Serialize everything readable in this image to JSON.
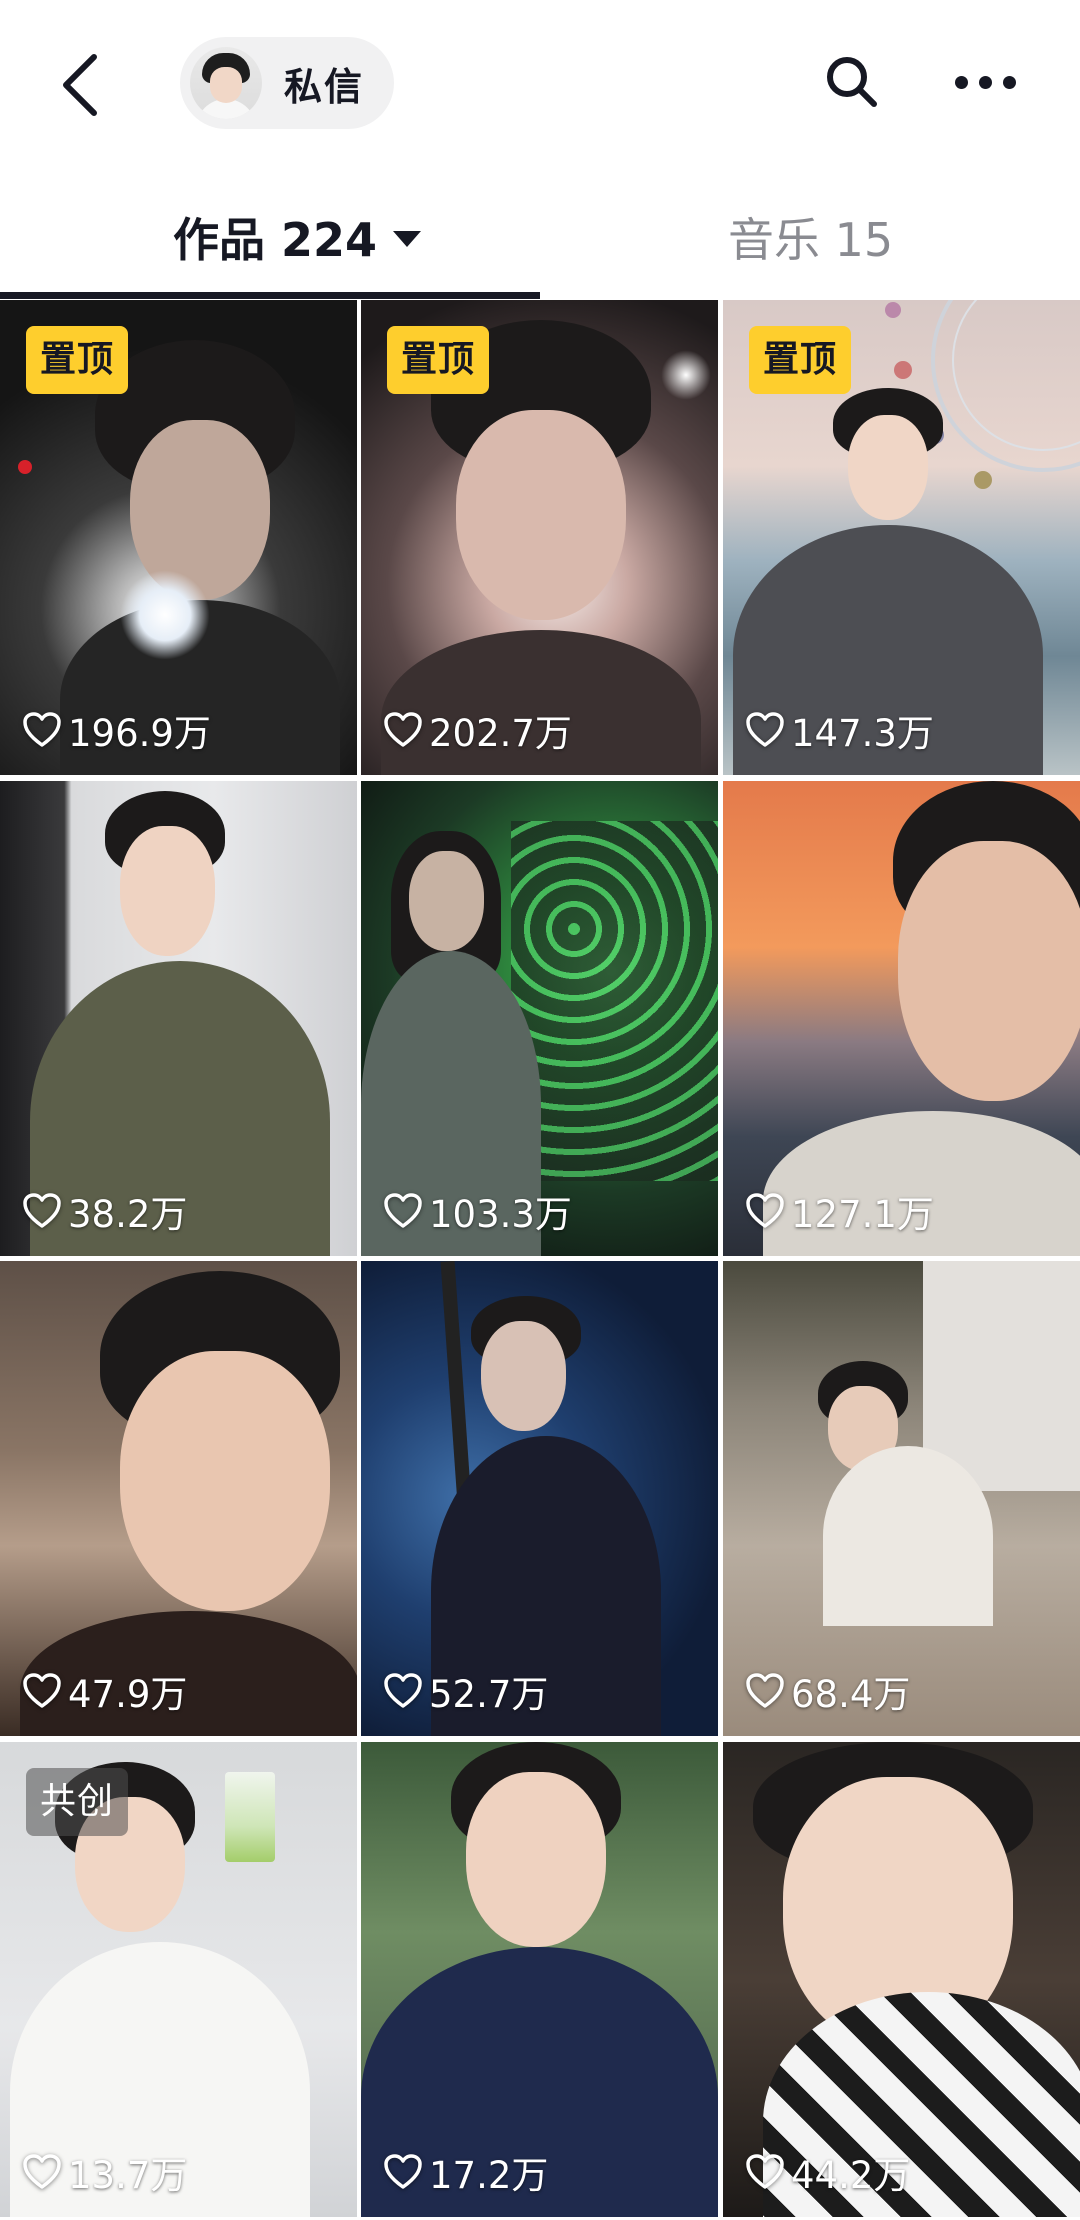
{
  "header": {
    "dm_label": "私信"
  },
  "tabs": [
    {
      "label": "作品 224",
      "active": true
    },
    {
      "label": "音乐 15",
      "active": false
    }
  ],
  "posts": [
    {
      "badge": "置顶",
      "likes": "196.9万"
    },
    {
      "badge": "置顶",
      "likes": "202.7万"
    },
    {
      "badge": "置顶",
      "likes": "147.3万"
    },
    {
      "badge": "",
      "likes": "38.2万"
    },
    {
      "badge": "",
      "likes": "103.3万"
    },
    {
      "badge": "",
      "likes": "127.1万"
    },
    {
      "badge": "",
      "likes": "47.9万"
    },
    {
      "badge": "",
      "likes": "52.7万"
    },
    {
      "badge": "",
      "likes": "68.4万"
    },
    {
      "badge": "共创",
      "likes": "13.7万"
    },
    {
      "badge": "",
      "likes": "17.2万"
    },
    {
      "badge": "",
      "likes": "44.2万"
    }
  ],
  "colors": {
    "pin_badge": "#fece2d",
    "text_primary": "#161823",
    "text_inactive": "#8a8b91"
  }
}
